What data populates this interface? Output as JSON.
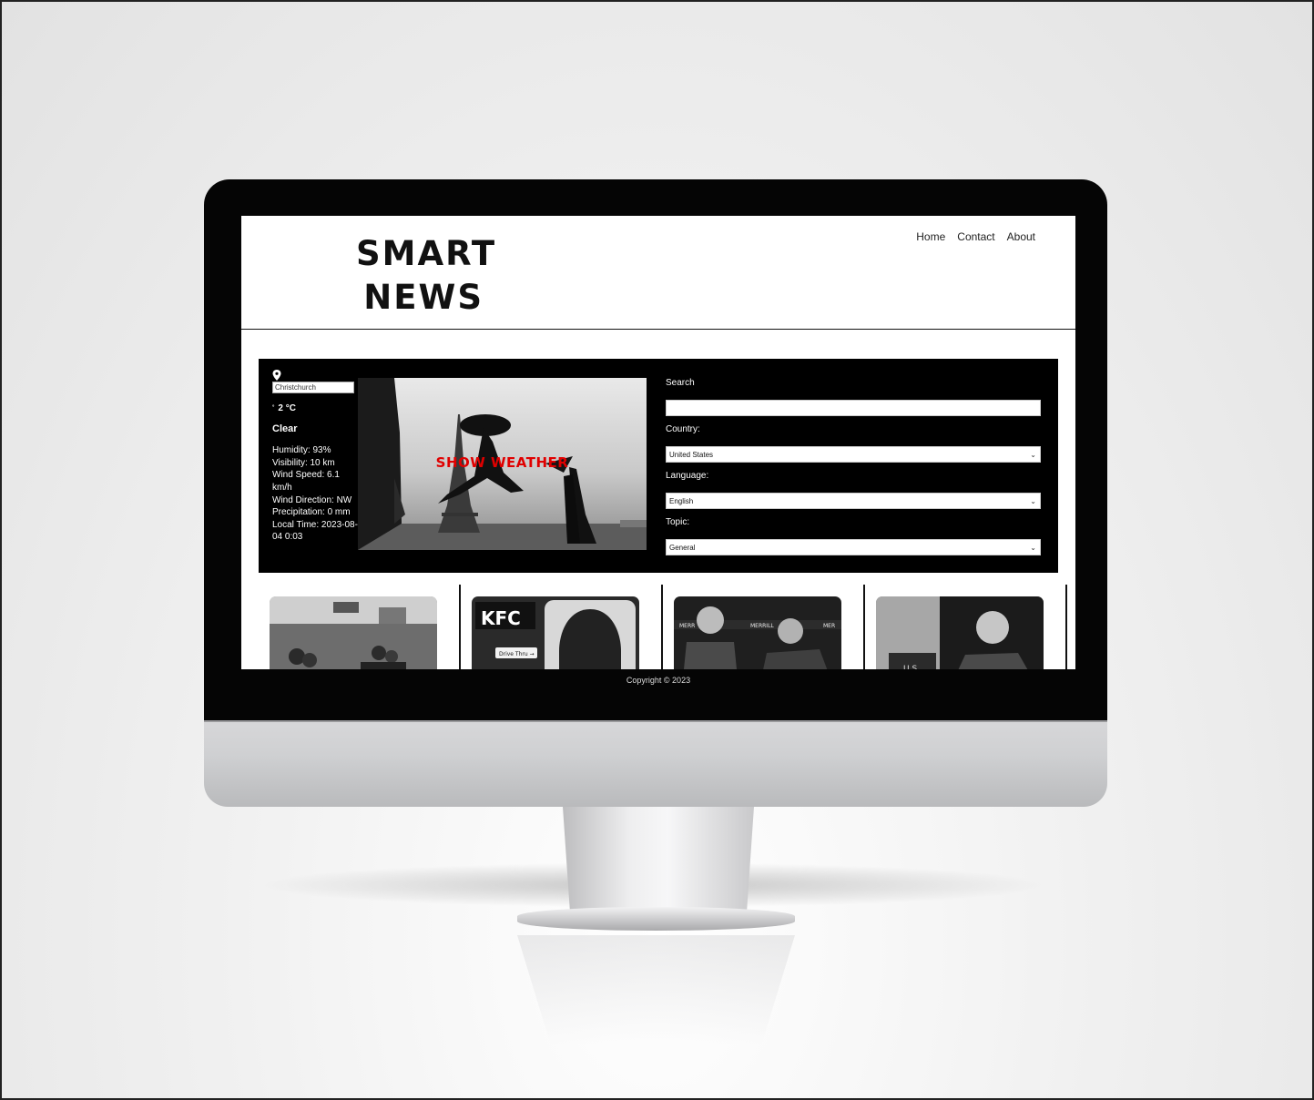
{
  "site": {
    "logo_line1": "SMART",
    "logo_line2": "NEWS",
    "nav": [
      {
        "label": "Home"
      },
      {
        "label": "Contact"
      },
      {
        "label": "About"
      }
    ]
  },
  "weather": {
    "location_value": "Christchurch",
    "temperature": "2 °C",
    "temperature_marker": "°",
    "condition": "Clear",
    "details": [
      "Humidity: 93%",
      "Visibility: 10 km",
      "Wind Speed: 6.1 km/h",
      "Wind Direction: NW",
      "Precipitation: 0 mm",
      "Local Time: 2023-08-04 0:03"
    ],
    "show_button": "SHOW WEATHER"
  },
  "filters": {
    "search_label": "Search",
    "search_value": "",
    "country_label": "Country:",
    "country_value": "United States",
    "language_label": "Language:",
    "language_value": "English",
    "topic_label": "Topic:",
    "topic_value": "General"
  },
  "footer": {
    "copyright": "Copyright © 2023"
  },
  "colors": {
    "panel": "#000000",
    "accent_red": "#e00000",
    "footer": "#050505"
  }
}
